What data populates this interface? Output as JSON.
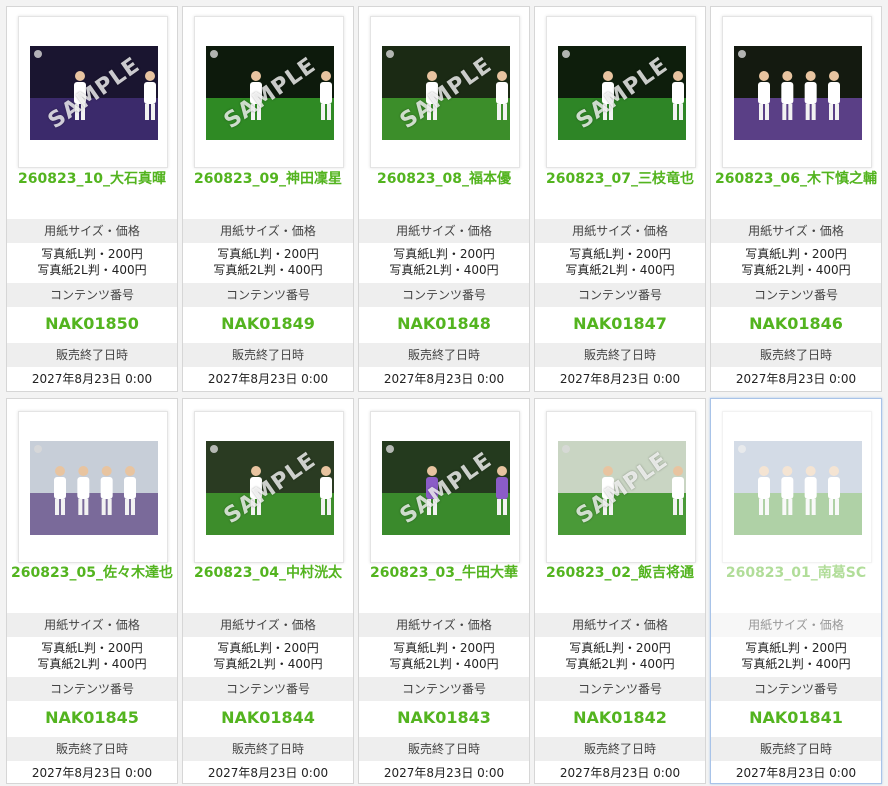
{
  "labels": {
    "size_price": "用紙サイズ・価格",
    "content_no": "コンテンツ番号",
    "sale_end": "販売終了日時"
  },
  "watermark": "SAMPLE",
  "colors": {
    "accent_green": "#53b41f",
    "label_bg": "#eeeeee"
  },
  "products": [
    {
      "title": "260823_10_大石真暉",
      "price_l": "写真紙L判・200円",
      "price_2l": "写真紙2L判・400円",
      "code": "NAK01850",
      "end_date": "2027年8月23日 0:00"
    },
    {
      "title": "260823_09_神田凜星",
      "price_l": "写真紙L判・200円",
      "price_2l": "写真紙2L判・400円",
      "code": "NAK01849",
      "end_date": "2027年8月23日 0:00"
    },
    {
      "title": "260823_08_福本優",
      "price_l": "写真紙L判・200円",
      "price_2l": "写真紙2L判・400円",
      "code": "NAK01848",
      "end_date": "2027年8月23日 0:00"
    },
    {
      "title": "260823_07_三枝竜也",
      "price_l": "写真紙L判・200円",
      "price_2l": "写真紙2L判・400円",
      "code": "NAK01847",
      "end_date": "2027年8月23日 0:00"
    },
    {
      "title": "260823_06_木下慎之輔",
      "price_l": "写真紙L判・200円",
      "price_2l": "写真紙2L判・400円",
      "code": "NAK01846",
      "end_date": "2027年8月23日 0:00"
    },
    {
      "title": "260823_05_佐々木達也",
      "price_l": "写真紙L判・200円",
      "price_2l": "写真紙2L判・400円",
      "code": "NAK01845",
      "end_date": "2027年8月23日 0:00"
    },
    {
      "title": "260823_04_中村洸太",
      "price_l": "写真紙L判・200円",
      "price_2l": "写真紙2L判・400円",
      "code": "NAK01844",
      "end_date": "2027年8月23日 0:00"
    },
    {
      "title": "260823_03_牛田大華",
      "price_l": "写真紙L判・200円",
      "price_2l": "写真紙2L判・400円",
      "code": "NAK01843",
      "end_date": "2027年8月23日 0:00"
    },
    {
      "title": "260823_02_飯吉将通",
      "price_l": "写真紙L判・200円",
      "price_2l": "写真紙2L判・400円",
      "code": "NAK01842",
      "end_date": "2027年8月23日 0:00"
    },
    {
      "title": "260823_01_南葛SC",
      "price_l": "写真紙L判・200円",
      "price_2l": "写真紙2L判・400円",
      "code": "NAK01841",
      "end_date": "2027年8月23日 0:00"
    }
  ]
}
